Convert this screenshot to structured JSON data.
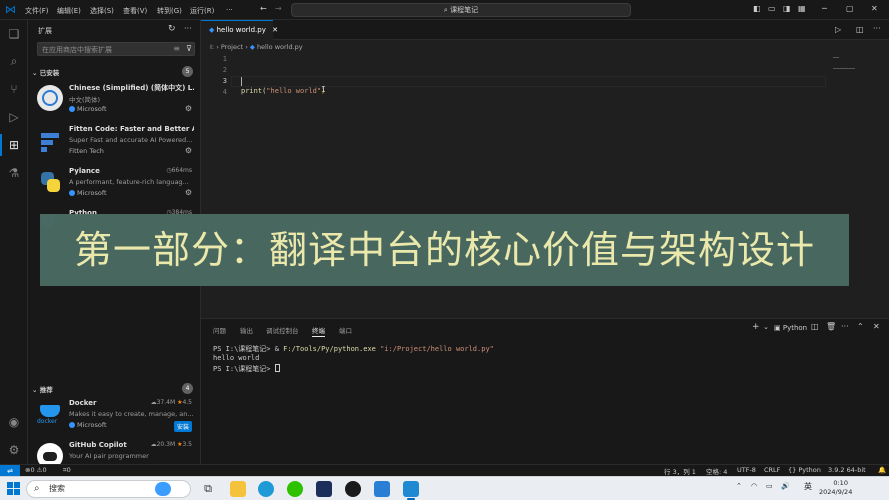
{
  "titlebar": {
    "menus": [
      "文件(F)",
      "编辑(E)",
      "选择(S)",
      "查看(V)",
      "转到(G)",
      "运行(R)",
      "···"
    ],
    "command_center": "课程笔记"
  },
  "sidebar": {
    "title": "扩展",
    "search_placeholder": "在应用商店中搜索扩展",
    "installed_label": "已安装",
    "installed_count": "5",
    "recommended_label": "推荐",
    "recommended_count": "4",
    "installed": [
      {
        "name": "Chinese (Simplified) (简体中文) L...",
        "desc": "中文(简体)",
        "publisher": "Microsoft",
        "verified": true,
        "downloads": ""
      },
      {
        "name": "Fitten Code: Faster and Better AI ...",
        "desc": "Super Fast and accurate AI Powered...",
        "publisher": "Fitten Tech",
        "verified": false,
        "downloads": ""
      },
      {
        "name": "Pylance",
        "desc": "A performant, feature-rich languag...",
        "publisher": "Microsoft",
        "verified": true,
        "downloads": "664ms"
      },
      {
        "name": "Python",
        "desc": "",
        "publisher": "",
        "verified": false,
        "downloads": "384ms"
      }
    ],
    "recommended": [
      {
        "name": "Docker",
        "desc": "Makes it easy to create, manage, an...",
        "publisher": "Microsoft",
        "downloads": "37.4M",
        "rating": "4.5",
        "install": "安装"
      },
      {
        "name": "GitHub Copilot",
        "desc": "Your AI pair programmer",
        "publisher": "",
        "downloads": "20.3M",
        "rating": "3.5",
        "install": ""
      }
    ]
  },
  "editor": {
    "tab_label": "hello world.py",
    "breadcrumb": [
      "I:",
      "Project",
      "hello world.py"
    ],
    "line_numbers": [
      "1",
      "2",
      "3",
      "4"
    ],
    "code_fn": "print(",
    "code_str": "\"hello world\"",
    "code_close": ")"
  },
  "panel": {
    "tabs": [
      "问题",
      "输出",
      "调试控制台",
      "终端",
      "端口"
    ],
    "active_tab": "终端",
    "shell_label": "Python",
    "terminal": {
      "line1_prompt": "PS I:\\课程笔记> & ",
      "line1_cmd": "F:/Tools/Py/python.exe",
      "line1_arg": " \"i:/Project/hello world.py\"",
      "line2": "hello world",
      "line3": "PS I:\\课程笔记> "
    }
  },
  "banner": {
    "text": "第一部分：翻译中台的核心价值与架构设计"
  },
  "statusbar": {
    "errors": "0",
    "warnings": "0",
    "ports": "0",
    "position": "行 3，列 1",
    "spaces": "空格: 4",
    "encoding": "UTF-8",
    "eol": "CRLF",
    "language": "{} Python",
    "interpreter": "3.9.2 64-bit"
  },
  "taskbar": {
    "search": "搜索",
    "ime": "英",
    "time": "0:10",
    "date": "2024/9/24"
  },
  "colors": {
    "accent": "#0078d4",
    "banner_bg": "#4a6a62",
    "banner_text": "#f2efb0"
  }
}
